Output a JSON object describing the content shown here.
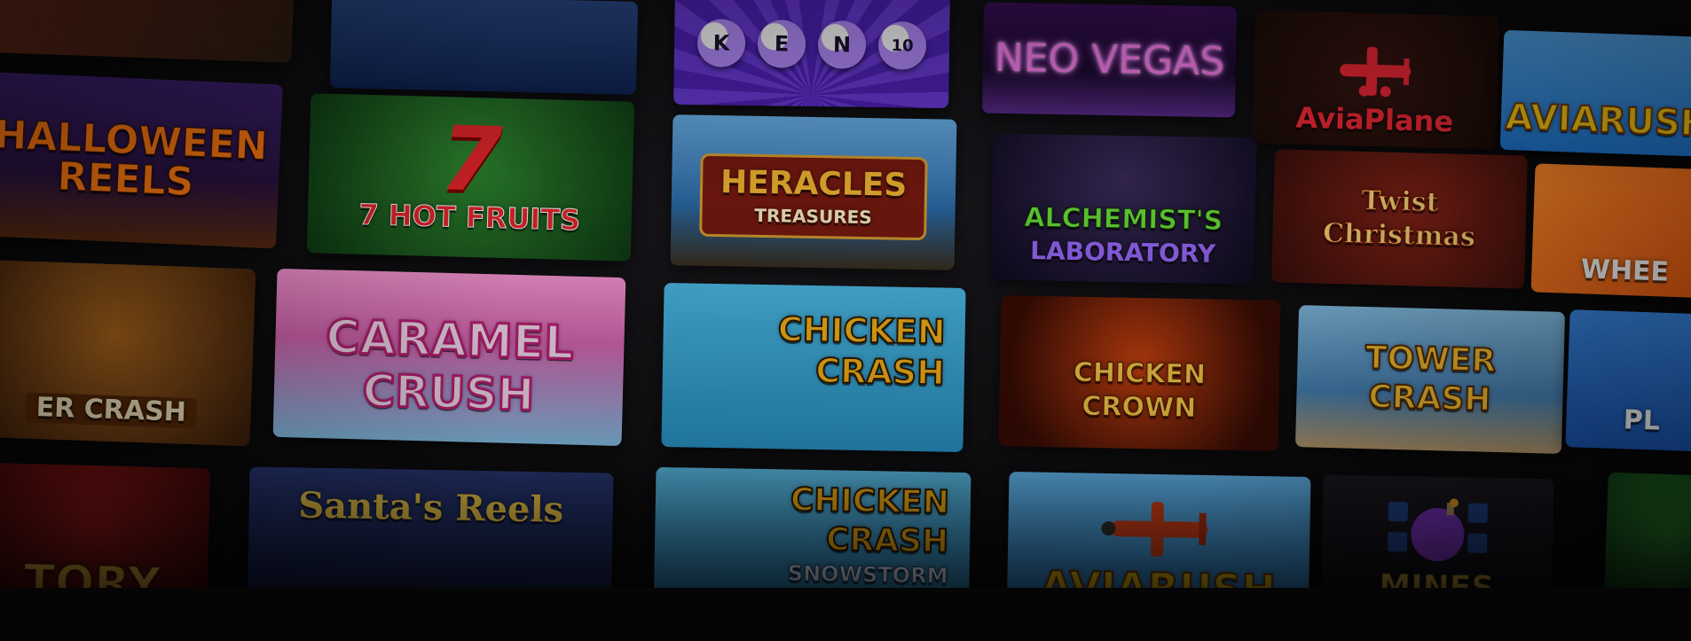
{
  "games": [
    {
      "id": "t-top-left",
      "title": ""
    },
    {
      "id": "t-santa-top",
      "title": ""
    },
    {
      "id": "t-keno",
      "title": "KENO",
      "balls": [
        "K",
        "E",
        "N",
        "10"
      ]
    },
    {
      "id": "t-neo-vegas",
      "title": "NEO VEGAS"
    },
    {
      "id": "t-aviaplane",
      "title": "AviaPlane"
    },
    {
      "id": "t-aviarush-top",
      "title": "AVIARUSH"
    },
    {
      "id": "t-halloween",
      "title": "HALLOWEEN REELS"
    },
    {
      "id": "t-7hot",
      "title": "7 HOT FRUITS",
      "big": "7"
    },
    {
      "id": "t-heracles",
      "title": "HERACLES",
      "sub": "TREASURES"
    },
    {
      "id": "t-alchemist",
      "title": "ALCHEMIST'S",
      "sub": "LABORATORY"
    },
    {
      "id": "t-twist",
      "title": "Twist",
      "sub": "Christmas"
    },
    {
      "id": "t-wheel",
      "title": "WHEE"
    },
    {
      "id": "t-beer",
      "title": "ER CRASH"
    },
    {
      "id": "t-caramel",
      "title": "CARAMEL",
      "sub": "CRUSH"
    },
    {
      "id": "t-chicken-crash",
      "title": "CHICKEN",
      "sub": "CRASH"
    },
    {
      "id": "t-chicken-crown",
      "title": "CHICKEN",
      "sub": "CROWN"
    },
    {
      "id": "t-tower-crash",
      "title": "TOWER",
      "sub": "CRASH"
    },
    {
      "id": "t-pl",
      "title": "PL"
    },
    {
      "id": "t-tory",
      "title": "TORY"
    },
    {
      "id": "t-santas-reels",
      "title": "Santa's Reels"
    },
    {
      "id": "t-chicken-snow",
      "title": "CHICKEN",
      "sub": "CRASH",
      "sub2": "SNOWSTORM"
    },
    {
      "id": "t-aviarush-bottom",
      "title": "AVIARUSH"
    },
    {
      "id": "t-mines",
      "title": "MINES"
    },
    {
      "id": "t-right-fruit",
      "title": ""
    }
  ],
  "colors": {
    "background": "#0b0b0d",
    "keno_purple": "#5b2fc4",
    "neo_pink": "#e85cff",
    "aviaplane_red": "#ff2a3a",
    "fruit_red": "#e8262a",
    "heracles_gold": "#f5b731",
    "alchemist_green": "#6de03a",
    "caramel_pink": "#f7a6e2",
    "chicken_yellow": "#ffb719",
    "tower_yellow": "#ffc933",
    "aviarush_yellow": "#ffd21a",
    "mines_gold": "#d9b145"
  }
}
